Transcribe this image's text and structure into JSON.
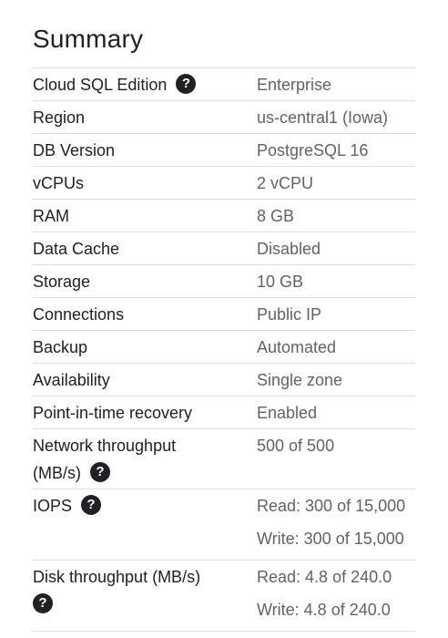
{
  "summary": {
    "title": "Summary",
    "rows": [
      {
        "label": "Cloud SQL Edition",
        "value": "Enterprise"
      },
      {
        "label": "Region",
        "value": "us-central1 (Iowa)"
      },
      {
        "label": "DB Version",
        "value": "PostgreSQL 16"
      },
      {
        "label": "vCPUs",
        "value": "2 vCPU"
      },
      {
        "label": "RAM",
        "value": "8 GB"
      },
      {
        "label": "Data Cache",
        "value": "Disabled"
      },
      {
        "label": "Storage",
        "value": "10 GB"
      },
      {
        "label": "Connections",
        "value": "Public IP"
      },
      {
        "label": "Backup",
        "value": "Automated"
      },
      {
        "label": "Availability",
        "value": "Single zone"
      },
      {
        "label": "Point-in-time recovery",
        "value": "Enabled"
      },
      {
        "label_line1": "Network throughput",
        "label_line2": "(MB/s)",
        "value": "500 of 500"
      },
      {
        "label": "IOPS",
        "value_read": "Read: 300 of 15,000",
        "value_write": "Write: 300 of 15,000"
      },
      {
        "label": "Disk throughput (MB/s)",
        "value_read": "Read: 4.8 of 240.0",
        "value_write": "Write: 4.8 of 240.0"
      }
    ]
  },
  "icons": {
    "help": "help-icon",
    "help_glyph": "?"
  }
}
